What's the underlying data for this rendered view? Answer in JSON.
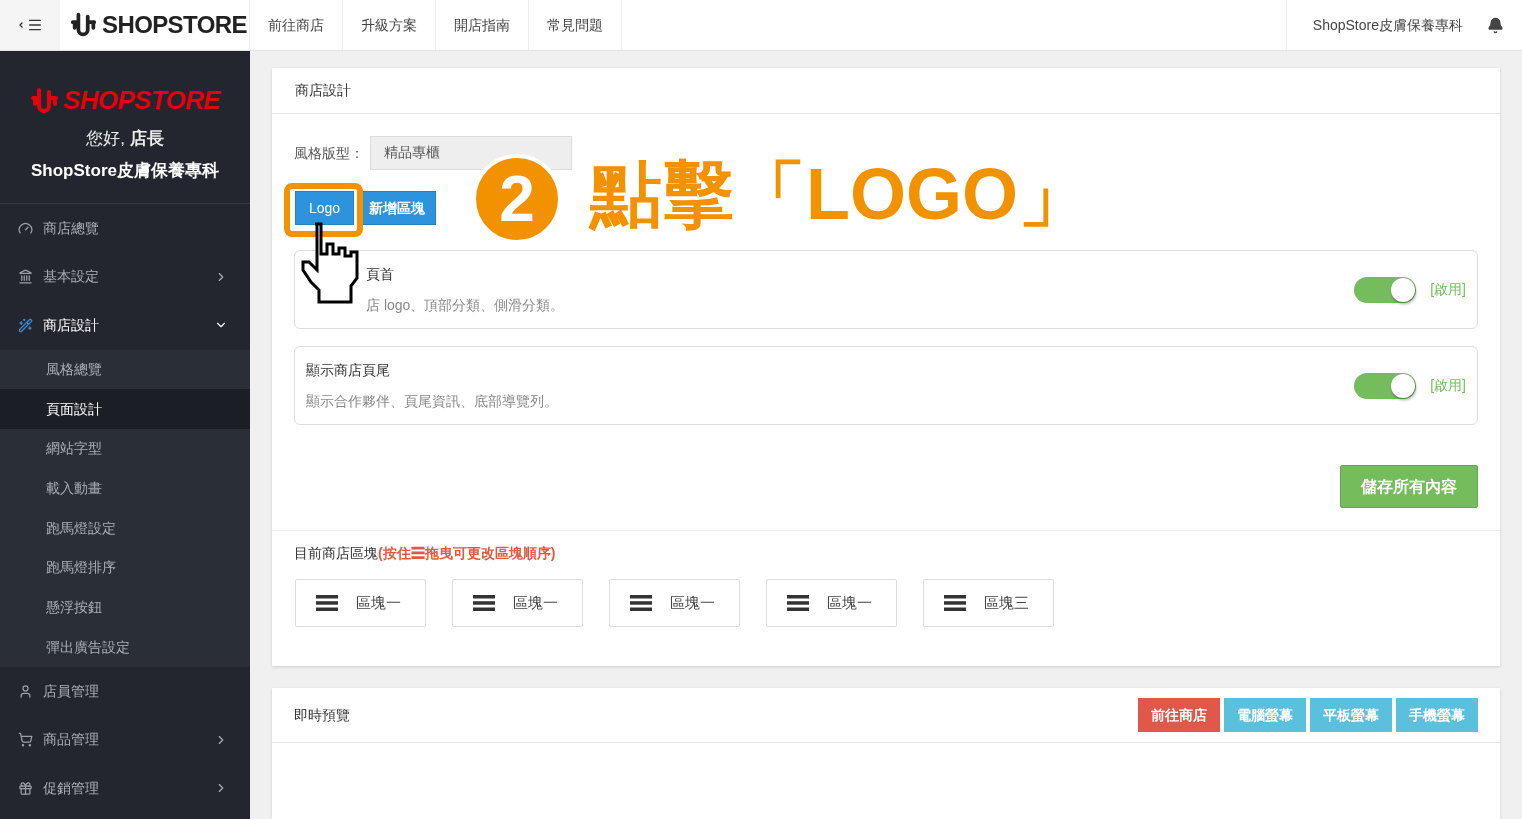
{
  "topbar": {
    "logo": "SHOPSTORE",
    "nav": [
      "前往商店",
      "升級方案",
      "開店指南",
      "常見問題"
    ],
    "store_name": "ShopStore皮膚保養專科"
  },
  "sidebar": {
    "brand": "SHOPSTORE",
    "greeting": "您好, **店長**",
    "store_name": "ShopStore皮膚保養專科",
    "items": [
      {
        "kind": "link",
        "label": "商店總覽"
      },
      {
        "kind": "group",
        "label": "基本設定",
        "expanded": false
      },
      {
        "kind": "group",
        "label": "商店設計",
        "expanded": true,
        "children": [
          {
            "label": "風格總覽",
            "selected": false
          },
          {
            "label": "頁面設計",
            "selected": true
          },
          {
            "label": "網站字型",
            "selected": false
          },
          {
            "label": "載入動畫",
            "selected": false
          },
          {
            "label": "跑馬燈設定",
            "selected": false
          },
          {
            "label": "跑馬燈排序",
            "selected": false
          },
          {
            "label": "懸浮按鈕",
            "selected": false
          },
          {
            "label": "彈出廣告設定",
            "selected": false
          }
        ]
      },
      {
        "kind": "link",
        "label": "店員管理"
      },
      {
        "kind": "group",
        "label": "商品管理",
        "expanded": false
      },
      {
        "kind": "group",
        "label": "促銷管理",
        "expanded": false
      }
    ]
  },
  "design_card": {
    "title": "商店設計",
    "style_label": "風格版型：",
    "style_value": "精品專櫃",
    "buttons": [
      "Logo",
      "新增區塊"
    ],
    "panels": [
      {
        "title": "頁首",
        "description": "店 logo、頂部分類、側滑分類。",
        "on": true,
        "status": "[啟用]"
      },
      {
        "title": "顯示商店頁尾",
        "description": "顯示合作夥伴、頁尾資訊、底部導覽列。",
        "on": true,
        "status": "[啟用]"
      }
    ],
    "save_button": "儲存所有內容",
    "blocks_heading": "目前商店區塊",
    "blocks_note": "(按住☰拖曳可更改區塊順序)",
    "blocks": [
      "區塊一",
      "區塊一",
      "區塊一",
      "區塊一",
      "區塊三"
    ]
  },
  "preview_card": {
    "title": "即時預覽",
    "buttons": [
      {
        "label": "前往商店",
        "kind": "danger"
      },
      {
        "label": "電腦螢幕",
        "kind": "info"
      },
      {
        "label": "平板螢幕",
        "kind": "info"
      },
      {
        "label": "手機螢幕",
        "kind": "info"
      }
    ]
  },
  "annotation": {
    "step": "2",
    "text": "點擊「LOGO」"
  }
}
